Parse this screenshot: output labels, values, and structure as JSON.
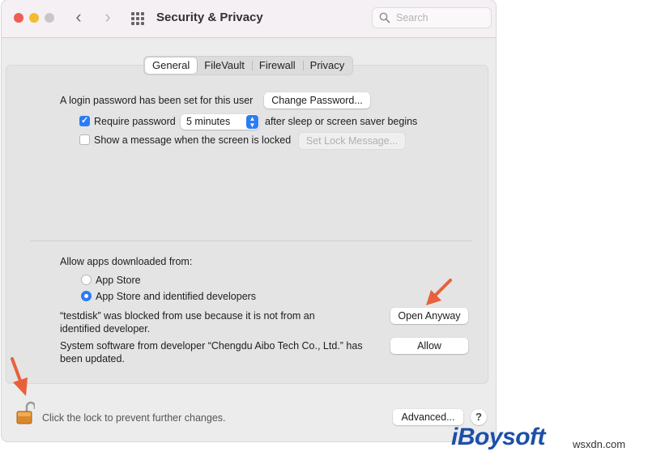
{
  "window": {
    "title": "Security & Privacy",
    "search_placeholder": "Search"
  },
  "tabs": [
    "General",
    "FileVault",
    "Firewall",
    "Privacy"
  ],
  "active_tab": "General",
  "login": {
    "text": "A login password has been set for this user",
    "change_button": "Change Password...",
    "require_label": "Require password",
    "require_checked": true,
    "delay_value": "5 minutes",
    "after_text": "after sleep or screen saver begins",
    "show_message_label": "Show a message when the screen is locked",
    "show_message_checked": false,
    "set_lock_button": "Set Lock Message..."
  },
  "apps": {
    "heading": "Allow apps downloaded from:",
    "options": [
      "App Store",
      "App Store and identified developers"
    ],
    "selected": "App Store and identified developers",
    "blocked_line1": "“testdisk” was blocked from use because it is not from an",
    "blocked_line2": "identified developer.",
    "open_anyway_button": "Open Anyway",
    "system_line1": "System software from developer “Chengdu Aibo Tech Co., Ltd.” has",
    "system_line2": "been updated.",
    "allow_button": "Allow"
  },
  "footer": {
    "lock_text": "Click the lock to prevent further changes.",
    "advanced_button": "Advanced...",
    "help_button": "?"
  },
  "branding": {
    "logo": "iBoysoft",
    "watermark": "wsxdn.com"
  },
  "colors": {
    "accent": "#2b7cf6",
    "annotation_arrow": "#e8613c",
    "brand": "#1c4fa8"
  }
}
